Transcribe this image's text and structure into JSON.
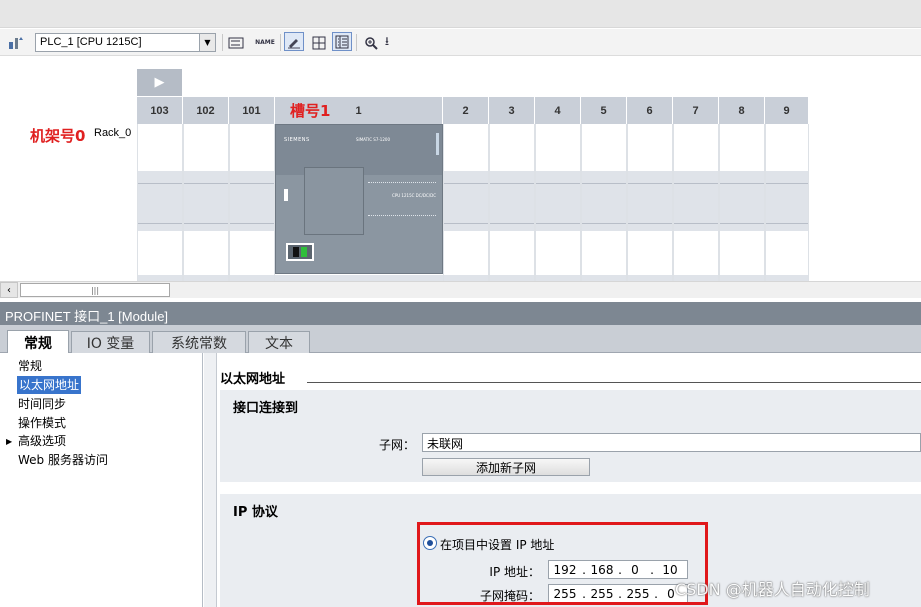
{
  "toolbar": {
    "device_value": "PLC_1 [CPU 1215C]",
    "icons": [
      "network-device-icon",
      "swap-icon",
      "name-icon",
      "edit-icon",
      "grid-icon",
      "columns-icon",
      "zoom-icon",
      "download-arrow-icon"
    ],
    "name_icon_text": "NAME"
  },
  "rack": {
    "slots": [
      "103",
      "102",
      "101",
      "1",
      "2",
      "3",
      "4",
      "5",
      "6",
      "7",
      "8",
      "9"
    ],
    "slot_annotation": "槽号1",
    "rack_annotation": "机架号0",
    "rack_name": "Rack_0",
    "plc_brand": "SIEMENS",
    "plc_model": "SIMATIC S7-1200",
    "plc_label": "CPU 1215C DC/DC/DC"
  },
  "scroll": {
    "thumb_glyph": "|||"
  },
  "inspector": {
    "title": "PROFINET 接口_1 [Module]",
    "tabs": [
      "常规",
      "IO 变量",
      "系统常数",
      "文本"
    ],
    "active_tab": 0
  },
  "nav": {
    "items": [
      {
        "label": "常规",
        "selected": false,
        "expandable": false
      },
      {
        "label": "以太网地址",
        "selected": true,
        "expandable": false
      },
      {
        "label": "时间同步",
        "selected": false,
        "expandable": false
      },
      {
        "label": "操作模式",
        "selected": false,
        "expandable": false
      },
      {
        "label": "高级选项",
        "selected": false,
        "expandable": true
      },
      {
        "label": "Web 服务器访问",
        "selected": false,
        "expandable": false
      }
    ]
  },
  "ethernet": {
    "section_title": "以太网地址",
    "interface_panel_title": "接口连接到",
    "subnet_label": "子网：",
    "subnet_value": "未联网",
    "add_subnet_button": "添加新子网",
    "ip_panel_title": "IP 协议",
    "set_ip_radio_label": "在项目中设置 IP 地址",
    "ip_label": "IP 地址：",
    "ip_octets": [
      "192",
      "168",
      "0",
      "10"
    ],
    "mask_label": "子网掩码：",
    "mask_octets": [
      "255",
      "255",
      "255",
      "0"
    ]
  },
  "watermark": "CSDN @机器人自动化控制",
  "colors": {
    "accent_red": "#e0181b",
    "selection_blue": "#3874cc",
    "header_gray": "#7d8792"
  }
}
